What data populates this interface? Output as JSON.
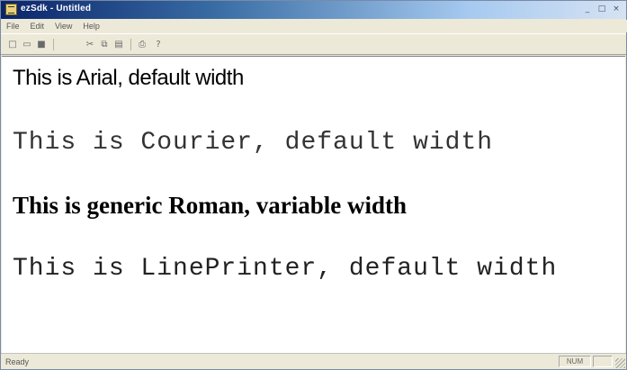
{
  "window": {
    "title": "ezSdk - Untitled",
    "controls": {
      "minimize": "_",
      "maximize": "□",
      "close": "×"
    }
  },
  "menubar": {
    "items": [
      {
        "label": "File"
      },
      {
        "label": "Edit"
      },
      {
        "label": "View"
      },
      {
        "label": "Help"
      }
    ]
  },
  "toolbar": {
    "buttons": [
      {
        "icon": "new-document-icon",
        "glyph": "□"
      },
      {
        "icon": "open-folder-icon",
        "glyph": "▭"
      },
      {
        "icon": "save-disk-icon",
        "glyph": "■"
      },
      {
        "icon": "cut-icon",
        "glyph": "✂"
      },
      {
        "icon": "copy-icon",
        "glyph": "⧉"
      },
      {
        "icon": "paste-icon",
        "glyph": "▤"
      },
      {
        "icon": "print-icon",
        "glyph": "⎙"
      },
      {
        "icon": "help-icon",
        "glyph": "?"
      }
    ]
  },
  "document": {
    "lines": [
      "This is Arial, default width",
      "This is Courier, default width",
      "This is generic Roman, variable width",
      "This is LinePrinter, default width"
    ]
  },
  "statusbar": {
    "text": "Ready",
    "panels": [
      "NUM",
      ""
    ]
  },
  "colors": {
    "title_start": "#0a246a",
    "title_end": "#a6caf0",
    "chrome": "#ece9d8",
    "canvas": "#ffffff"
  }
}
